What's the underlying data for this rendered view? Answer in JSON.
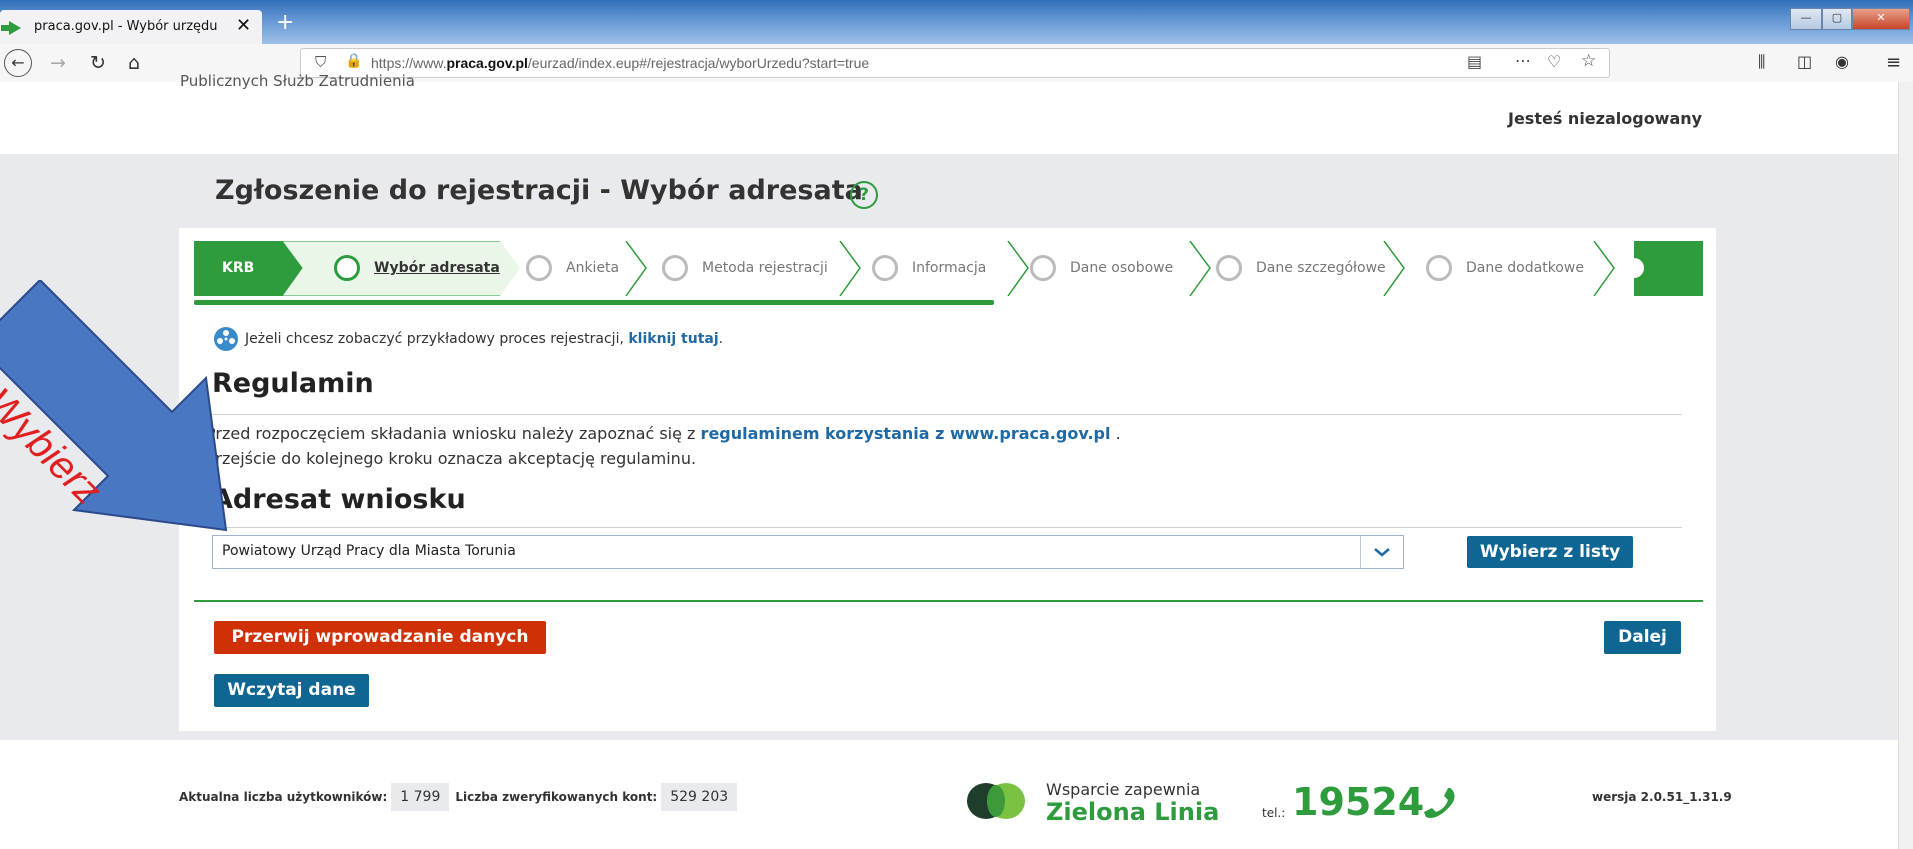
{
  "browser": {
    "tab_title": "praca.gov.pl - Wybór urzędu",
    "tab_close": "✕",
    "new_tab": "+",
    "url_prefix": "https://www.",
    "url_domain": "praca.gov.pl",
    "url_path": "/eurzad/index.eup#/rejestracja/wyborUrzedu?start=true",
    "window_min": "—",
    "window_max": "▢",
    "window_close": "✕"
  },
  "header": {
    "cut_text": "Publicznych Służb Zatrudnienia",
    "login_status": "Jesteś niezalogowany"
  },
  "page": {
    "title": "Zgłoszenie do rejestracji - Wybór adresata",
    "help_symbol": "?"
  },
  "steps": [
    {
      "label": "KRB"
    },
    {
      "label": "Wybór adresata"
    },
    {
      "label": "Ankieta"
    },
    {
      "label": "Metoda rejestracji"
    },
    {
      "label": "Informacja"
    },
    {
      "label": "Dane osobowe"
    },
    {
      "label": "Dane szczegółowe"
    },
    {
      "label": "Dane dodatkowe"
    }
  ],
  "info": {
    "text": "Jeżeli chcesz zobaczyć przykładowy proces rejestracji,",
    "link": "kliknij tutaj",
    "end": "."
  },
  "regulamin": {
    "heading": "Regulamin",
    "line1_text": "Przed rozpoczęciem składania wniosku należy zapoznać się z",
    "line1_link": "regulaminem korzystania z www.praca.gov.pl",
    "line1_end": ".",
    "line2": "Przejście do kolejnego kroku oznacza akceptację regulaminu."
  },
  "adresat": {
    "heading": "Adresat wniosku",
    "selected": "Powiatowy Urząd Pracy dla Miasta Torunia",
    "choose_button": "Wybierz z listy"
  },
  "actions": {
    "abort": "Przerwij wprowadzanie danych",
    "next": "Dalej",
    "load": "Wczytaj dane"
  },
  "footer": {
    "users_label": "Aktualna liczba użytkowników:",
    "users_value": "1 799",
    "verified_label": "Liczba zweryfikowanych kont:",
    "verified_value": "529 203",
    "support_line1": "Wsparcie zapewnia",
    "support_line2": "Zielona Linia",
    "tel_label": "tel.:",
    "tel_number": "19524",
    "version": "wersja 2.0.51_1.31.9"
  },
  "annotation": {
    "arrow_text": "Wybierz"
  },
  "colors": {
    "green": "#2e9b3c",
    "blue": "#0f6693",
    "red": "#cf3006",
    "arrow_blue": "#4a77c4",
    "arrow_text": "#e02020"
  }
}
